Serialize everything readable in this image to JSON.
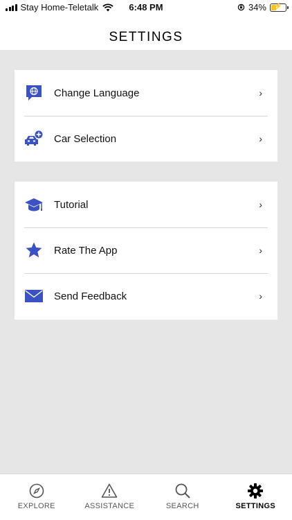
{
  "status_bar": {
    "carrier": "Stay Home-Teletalk",
    "time": "6:48 PM",
    "battery": "34%",
    "battery_level": 0.34,
    "icons": [
      "signal-icon",
      "wifi-icon",
      "orientation-lock-icon",
      "battery-icon"
    ]
  },
  "header": {
    "title": "SETTINGS"
  },
  "colors": {
    "accent": "#3a52c4",
    "background": "#e6e6e6",
    "card": "#ffffff"
  },
  "settings_groups": [
    {
      "items": [
        {
          "label": "Change Language",
          "icon": "language-globe-icon"
        },
        {
          "label": "Car Selection",
          "icon": "car-add-icon"
        }
      ]
    },
    {
      "items": [
        {
          "label": "Tutorial",
          "icon": "graduation-cap-icon"
        },
        {
          "label": "Rate The App",
          "icon": "star-icon"
        },
        {
          "label": "Send Feedback",
          "icon": "envelope-icon"
        }
      ]
    }
  ],
  "chevron": "›",
  "tab_bar": {
    "tabs": [
      {
        "label": "EXPLORE",
        "icon": "compass-icon"
      },
      {
        "label": "ASSISTANCE",
        "icon": "warning-icon"
      },
      {
        "label": "SEARCH",
        "icon": "search-icon"
      },
      {
        "label": "SETTINGS",
        "icon": "gear-icon",
        "active": true
      }
    ]
  }
}
